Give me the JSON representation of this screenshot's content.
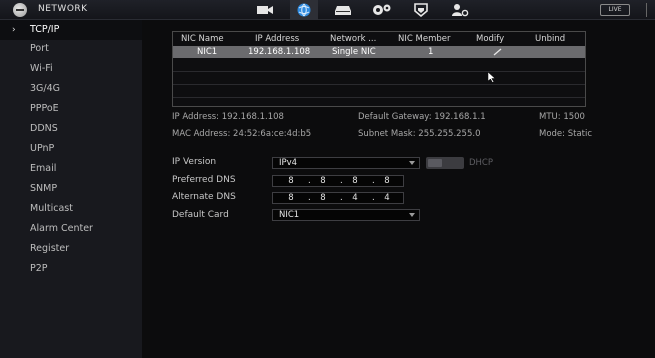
{
  "header": {
    "title": "NETWORK",
    "live_label": "LIVE",
    "icons": [
      "camera-icon",
      "network-icon",
      "storage-icon",
      "system-settings-icon",
      "security-shield-icon",
      "account-icon"
    ]
  },
  "sidebar": {
    "items": [
      {
        "label": "TCP/IP",
        "active": true
      },
      {
        "label": "Port"
      },
      {
        "label": "Wi-Fi"
      },
      {
        "label": "3G/4G"
      },
      {
        "label": "PPPoE"
      },
      {
        "label": "DDNS"
      },
      {
        "label": "UPnP"
      },
      {
        "label": "Email"
      },
      {
        "label": "SNMP"
      },
      {
        "label": "Multicast"
      },
      {
        "label": "Alarm Center"
      },
      {
        "label": "Register"
      },
      {
        "label": "P2P"
      }
    ]
  },
  "nic_table": {
    "headers": [
      "NIC Name",
      "IP Address",
      "Network ...",
      "NIC Member",
      "Modify",
      "Unbind"
    ],
    "rows": [
      {
        "nic_name": "NIC1",
        "ip_address": "192.168.1.108",
        "network_mode": "Single NIC",
        "nic_member": "1"
      }
    ]
  },
  "info": {
    "ip_address": "IP Address: 192.168.1.108",
    "default_gateway": "Default Gateway: 192.168.1.1",
    "mtu": "MTU: 1500",
    "mac_address": "MAC Address: 24:52:6a:ce:4d:b5",
    "subnet_mask": "Subnet Mask: 255.255.255.0",
    "mode": "Mode: Static"
  },
  "form": {
    "ip_version_label": "IP Version",
    "ip_version_value": "IPv4",
    "dhcp_label": "DHCP",
    "preferred_dns_label": "Preferred DNS",
    "preferred_dns": [
      "8",
      "8",
      "8",
      "8"
    ],
    "alternate_dns_label": "Alternate DNS",
    "alternate_dns": [
      "8",
      "8",
      "4",
      "4"
    ],
    "default_card_label": "Default Card",
    "default_card_value": "NIC1"
  }
}
